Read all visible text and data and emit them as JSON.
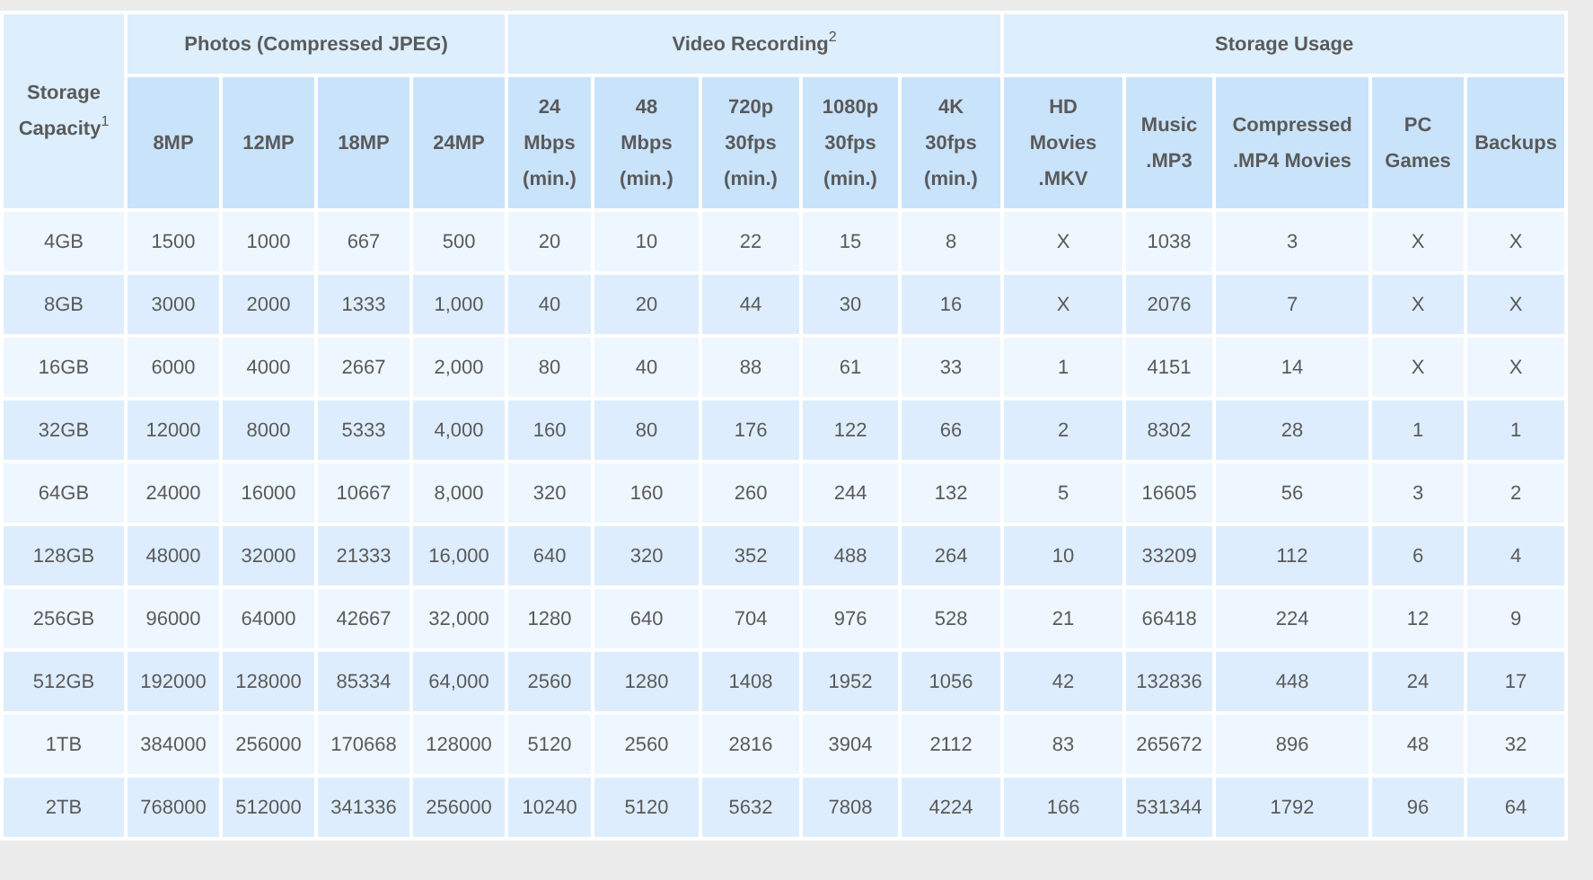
{
  "table": {
    "first_column": "Storage\nCapacity$^{1}$",
    "groups": [
      {
        "label": "Photos (Compressed JPEG)",
        "columns": [
          "8MP",
          "12MP",
          "18MP",
          "24MP"
        ]
      },
      {
        "label": "Video Recording$^{2}$",
        "columns": [
          "24\nMbps\n(min.)",
          "48\nMbps\n(min.)",
          "720p\n30fps\n(min.)",
          "1080p\n30fps\n(min.)",
          "4K\n30fps\n(min.)"
        ]
      },
      {
        "label": "Storage Usage",
        "columns": [
          "HD\nMovies\n.MKV",
          "Music\n.MP3",
          "Compressed\n.MP4 Movies",
          "PC\nGames",
          "Backups"
        ]
      }
    ],
    "rows": [
      {
        "capacity": "4GB",
        "cells": [
          "1500",
          "1000",
          "667",
          "500",
          "20",
          "10",
          "22",
          "15",
          "8",
          "X",
          "1038",
          "3",
          "X",
          "X"
        ]
      },
      {
        "capacity": "8GB",
        "cells": [
          "3000",
          "2000",
          "1333",
          "1,000",
          "40",
          "20",
          "44",
          "30",
          "16",
          "X",
          "2076",
          "7",
          "X",
          "X"
        ]
      },
      {
        "capacity": "16GB",
        "cells": [
          "6000",
          "4000",
          "2667",
          "2,000",
          "80",
          "40",
          "88",
          "61",
          "33",
          "1",
          "4151",
          "14",
          "X",
          "X"
        ]
      },
      {
        "capacity": "32GB",
        "cells": [
          "12000",
          "8000",
          "5333",
          "4,000",
          "160",
          "80",
          "176",
          "122",
          "66",
          "2",
          "8302",
          "28",
          "1",
          "1"
        ]
      },
      {
        "capacity": "64GB",
        "cells": [
          "24000",
          "16000",
          "10667",
          "8,000",
          "320",
          "160",
          "260",
          "244",
          "132",
          "5",
          "16605",
          "56",
          "3",
          "2"
        ]
      },
      {
        "capacity": "128GB",
        "cells": [
          "48000",
          "32000",
          "21333",
          "16,000",
          "640",
          "320",
          "352",
          "488",
          "264",
          "10",
          "33209",
          "112",
          "6",
          "4"
        ]
      },
      {
        "capacity": "256GB",
        "cells": [
          "96000",
          "64000",
          "42667",
          "32,000",
          "1280",
          "640",
          "704",
          "976",
          "528",
          "21",
          "66418",
          "224",
          "12",
          "9"
        ]
      },
      {
        "capacity": "512GB",
        "cells": [
          "192000",
          "128000",
          "85334",
          "64,000",
          "2560",
          "1280",
          "1408",
          "1952",
          "1056",
          "42",
          "132836",
          "448",
          "24",
          "17"
        ]
      },
      {
        "capacity": "1TB",
        "cells": [
          "384000",
          "256000",
          "170668",
          "128000",
          "5120",
          "2560",
          "2816",
          "3904",
          "2112",
          "83",
          "265672",
          "896",
          "48",
          "32"
        ]
      },
      {
        "capacity": "2TB",
        "cells": [
          "768000",
          "512000",
          "341336",
          "256000",
          "10240",
          "5120",
          "5632",
          "7808",
          "4224",
          "166",
          "531344",
          "1792",
          "96",
          "64"
        ]
      }
    ]
  }
}
